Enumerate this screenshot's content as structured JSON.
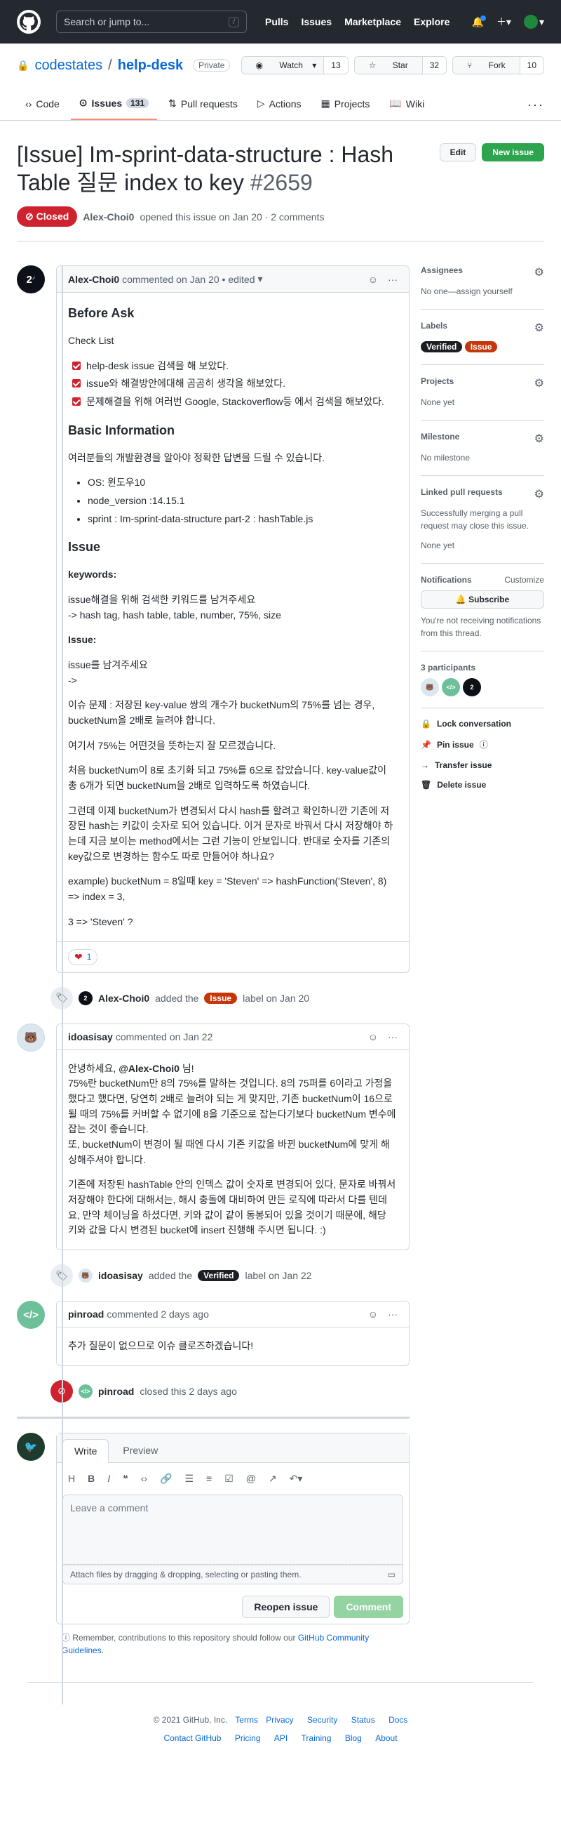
{
  "header": {
    "search_placeholder": "Search or jump to...",
    "slash": "/",
    "nav": [
      "Pulls",
      "Issues",
      "Marketplace",
      "Explore"
    ]
  },
  "repo": {
    "owner": "codestates",
    "sep": "/",
    "name": "help-desk",
    "visibility": "Private",
    "watch": "Watch",
    "watch_count": "13",
    "star": "Star",
    "star_count": "32",
    "fork": "Fork",
    "fork_count": "10"
  },
  "tabs": [
    {
      "label": "Code"
    },
    {
      "label": "Issues",
      "count": "131"
    },
    {
      "label": "Pull requests"
    },
    {
      "label": "Actions"
    },
    {
      "label": "Projects"
    },
    {
      "label": "Wiki"
    }
  ],
  "issue": {
    "title": "[Issue] Im-sprint-data-structure : Hash Table 질문 index to key",
    "number": "#2659",
    "edit": "Edit",
    "new_issue": "New issue",
    "status": "Closed",
    "author": "Alex-Choi0",
    "opened": "opened this issue on Jan 20 · 2 comments"
  },
  "first_comment": {
    "author": "Alex-Choi0",
    "meta": "commented on Jan 20 • edited",
    "h_before": "Before Ask",
    "h_check": "Check List",
    "checks": [
      "help-desk issue 검색을 해 보았다.",
      "issue와 해결방안에대해 곰곰히 생각을 해보았다.",
      "문제해결을 위해 여러번 Google, Stackoverflow등 에서 검색을 해보았다."
    ],
    "h_basic": "Basic Information",
    "basic_intro": "여러분들의 개발환경을 알아야 정확한 답변을 드릴 수 있습니다.",
    "env": [
      "OS: 윈도우10",
      "node_version :14.15.1",
      "sprint : Im-sprint-data-structure part-2 : hashTable.js"
    ],
    "h_issue": "Issue",
    "kw_label": "keywords:",
    "kw1": "issue해결을 위해 검색한 키워드를 남겨주세요",
    "kw2": "-> hash tag, hash table, table, number, 75%, size",
    "issue_label": "Issue:",
    "issue1": "issue를 남겨주세요",
    "issue2": "->",
    "p1": "이슈 문제 : 저장된 key-value 쌍의 개수가 bucketNum의 75%를 넘는 경우, bucketNum을 2배로 늘려야 합니다.",
    "p2": "여기서 75%는 어떤것을 뜻하는지 잘 모르겠습니다.",
    "p3": "처음 bucketNum이 8로 초기화 되고 75%를 6으로 잡았습니다. key-value값이 총 6개가 되면 bucketNum을 2배로 입력하도록 하였습니다.",
    "p4": "그런데 이제 bucketNum가 변경되서 다시 hash를 할려고 확인하니깐 기존에 저장된 hash는 키값이 숫자로 되어 있습니다. 이거 문자로 바꿔서 다시 저장해야 하는데 지금 보이는 method에서는 그런 기능이 안보입니다. 반대로 숫자를 기존의 key값으로 변경하는 함수도 따로 만들어야 하나요?",
    "p5": "example) bucketNum = 8일때 key = 'Steven' => hashFunction('Steven', 8) => index = 3,",
    "p6": "3 => 'Steven' ?",
    "reaction_count": "1"
  },
  "event1": {
    "author": "Alex-Choi0",
    "text1": "added the",
    "label": "Issue",
    "text2": "label on Jan 20"
  },
  "second_comment": {
    "author": "idoasisay",
    "meta": "commented on Jan 22",
    "greet": "안녕하세요,",
    "mention": "@Alex-Choi0",
    "greet2": "님!",
    "p1": "75%란 bucketNum만 8의 75%를 말하는 것입니다. 8의 75퍼를 6이라고 가정을 했다고 했다면, 당연히 2배로 늘려야 되는 게 맞지만, 기존 bucketNum이 16으로 될 때의 75%를 커버할 수 없기에 8을 기준으로 잡는다기보다 bucketNum 변수에 잡는 것이 좋습니다.",
    "p2": "또, bucketNum이 변경이 될 때엔 다시 기존 키값을 바뀐 bucketNum에 맞게 해싱해주셔야 합니다.",
    "p3": "기존에 저장된 hashTable 안의 인덱스 값이 숫자로 변경되어 있다, 문자로 바꿔서 저장해야 한다에 대해서는, 해시 충돌에 대비하여 만든 로직에 따라서 다를 텐데요, 만약 체이닝을 하셨다면, 키와 값이 같이 동봉되어 있을 것이기 때문에, 해당 키와 값을 다시 변경된 bucket에 insert 진행해 주시면 됩니다. :)"
  },
  "event2": {
    "author": "idoasisay",
    "text1": "added the",
    "label": "Verified",
    "text2": "label on Jan 22"
  },
  "third_comment": {
    "author": "pinroad",
    "meta": "commented 2 days ago",
    "body": "추가 질문이 없으므로 이슈 클로즈하겠습니다!"
  },
  "event3": {
    "author": "pinroad",
    "text": "closed this 2 days ago"
  },
  "editor": {
    "write": "Write",
    "preview": "Preview",
    "placeholder": "Leave a comment",
    "attach": "Attach files by dragging & dropping, selecting or pasting them.",
    "reopen": "Reopen issue",
    "comment": "Comment",
    "remind_pre": "Remember, contributions to this repository should follow our",
    "remind_link": "GitHub Community Guidelines",
    "remind_post": "."
  },
  "sidebar": {
    "assignees": "Assignees",
    "assignees_val": "No one—assign yourself",
    "labels": "Labels",
    "label_verified": "Verified",
    "label_issue": "Issue",
    "projects": "Projects",
    "projects_val": "None yet",
    "milestone": "Milestone",
    "milestone_val": "No milestone",
    "linked": "Linked pull requests",
    "linked_desc": "Successfully merging a pull request may close this issue.",
    "linked_val": "None yet",
    "notifications": "Notifications",
    "customize": "Customize",
    "subscribe": "Subscribe",
    "notif_desc": "You're not receiving notifications from this thread.",
    "participants": "3 participants",
    "lock": "Lock conversation",
    "pin": "Pin issue",
    "transfer": "Transfer issue",
    "delete": "Delete issue"
  },
  "footer": {
    "copyright": "© 2021 GitHub, Inc.",
    "links1": [
      "Terms",
      "Privacy",
      "Security",
      "Status",
      "Docs"
    ],
    "links2": [
      "Contact GitHub",
      "Pricing",
      "API",
      "Training",
      "Blog",
      "About"
    ]
  },
  "colors": {
    "closed": "#cf222e",
    "issue_label": "#c5360a",
    "verified_label": "#1b1f23",
    "green": "#2da44e"
  }
}
